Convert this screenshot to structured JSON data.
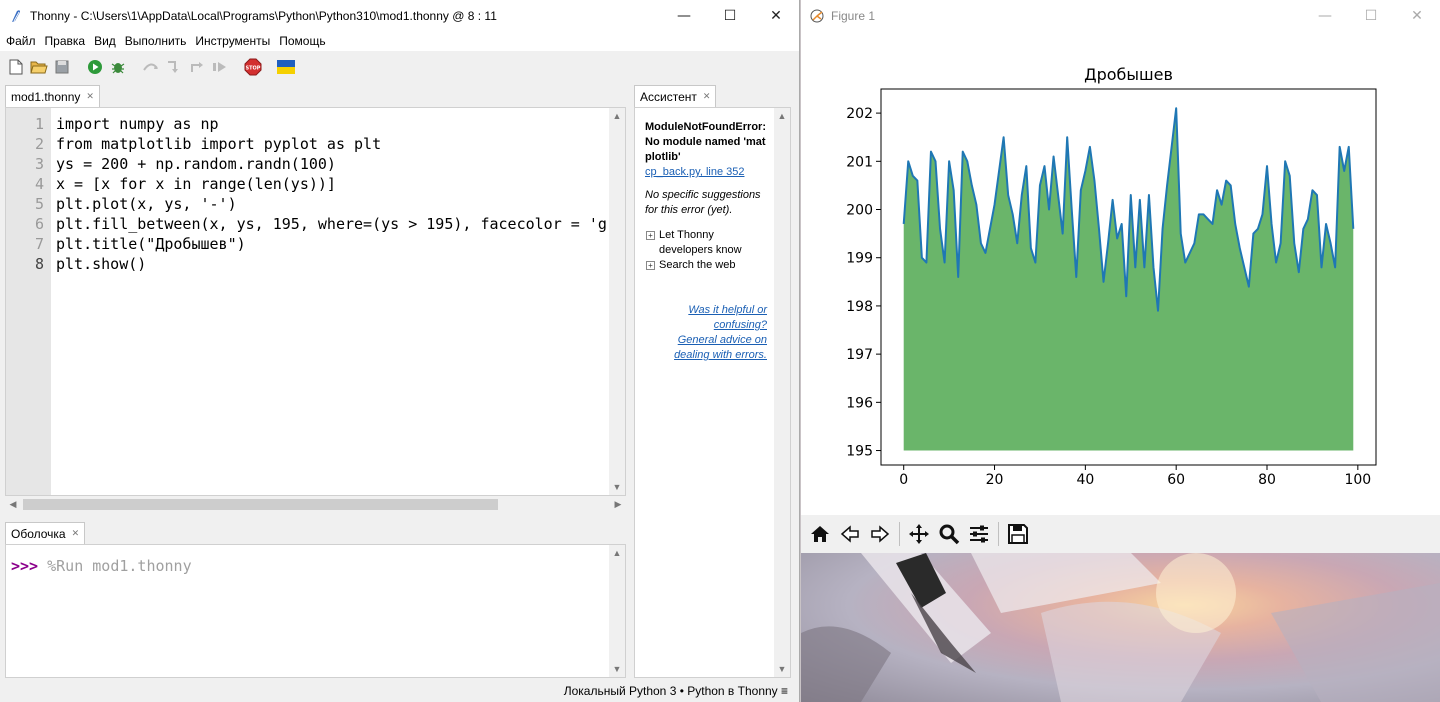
{
  "thonny": {
    "title": "Thonny  -  C:\\Users\\1\\AppData\\Local\\Programs\\Python\\Python310\\mod1.thonny  @  8 : 11",
    "menu": [
      "Файл",
      "Правка",
      "Вид",
      "Выполнить",
      "Инструменты",
      "Помощь"
    ],
    "toolbar_icons": [
      "new-file-icon",
      "open-file-icon",
      "save-icon",
      "run-icon",
      "debug-icon",
      "step-over-icon",
      "step-into-icon",
      "step-out-icon",
      "resume-icon",
      "stop-icon",
      "ukraine-flag-icon"
    ],
    "editor_tab": "mod1.thonny",
    "code_lines": [
      "import numpy as np",
      "from matplotlib import pyplot as plt",
      "ys = 200 + np.random.randn(100)",
      "x = [x for x in range(len(ys))]",
      "plt.plot(x, ys, '-')",
      "plt.fill_between(x, ys, 195, where=(ys > 195), facecolor = 'g",
      "plt.title(\"Дробышев\")",
      "plt.show()"
    ],
    "line_numbers": [
      "1",
      "2",
      "3",
      "4",
      "5",
      "6",
      "7",
      "8"
    ],
    "shell_tab": "Оболочка",
    "shell_prompt": ">>>",
    "shell_command": " %Run mod1.thonny",
    "assistant_tab": "Ассистент",
    "assistant": {
      "error": "ModuleNotFoundError: No module named 'matplotlib'",
      "location_link": "cp_back.py, line 352",
      "no_suggestions": "No specific suggestions for this error (yet).",
      "items": [
        "Let Thonny developers know",
        "Search the web"
      ],
      "footer_line1": "Was it helpful or confusing?",
      "footer_line2": "General advice on dealing with errors."
    },
    "status": "Локальный Python 3  •  Python в Thonny  ≡"
  },
  "figure": {
    "title": "Figure 1",
    "toolbar_icons": [
      "home-icon",
      "back-icon",
      "forward-icon",
      "pan-icon",
      "zoom-icon",
      "configure-icon",
      "save-icon"
    ]
  },
  "chart_data": {
    "type": "line",
    "title": "Дробышев",
    "xlabel": "",
    "ylabel": "",
    "x_ticks": [
      0,
      20,
      40,
      60,
      80,
      100
    ],
    "y_ticks": [
      195,
      196,
      197,
      198,
      199,
      200,
      201,
      202
    ],
    "xlim": [
      -5,
      104
    ],
    "ylim": [
      194.7,
      202.5
    ],
    "fill_baseline": 195,
    "line_color": "#1f77b4",
    "fill_color": "#5aad5a",
    "grid": false,
    "values": [
      199.7,
      201.0,
      200.7,
      200.6,
      199.0,
      198.9,
      201.2,
      201.0,
      199.6,
      198.9,
      201.0,
      200.4,
      198.6,
      201.2,
      201.0,
      200.5,
      200.1,
      199.3,
      199.1,
      199.6,
      200.1,
      200.8,
      201.5,
      200.3,
      199.9,
      199.3,
      200.3,
      200.9,
      199.2,
      198.9,
      200.5,
      200.9,
      200.0,
      201.1,
      200.3,
      199.5,
      201.5,
      200.0,
      198.6,
      200.4,
      200.8,
      201.3,
      200.6,
      199.6,
      198.5,
      199.3,
      200.2,
      199.4,
      199.7,
      198.2,
      200.3,
      198.8,
      200.2,
      198.8,
      200.3,
      198.8,
      197.9,
      199.6,
      200.5,
      201.3,
      202.1,
      199.5,
      198.9,
      199.1,
      199.3,
      199.9,
      199.9,
      199.8,
      199.7,
      200.4,
      200.1,
      200.6,
      200.5,
      199.7,
      199.2,
      198.8,
      198.4,
      199.5,
      199.6,
      199.9,
      200.9,
      199.7,
      198.9,
      199.3,
      201.0,
      200.7,
      199.3,
      198.7,
      199.6,
      199.8,
      200.4,
      200.3,
      198.8,
      199.7,
      199.3,
      198.8,
      201.3,
      200.8,
      201.3,
      199.6
    ]
  }
}
